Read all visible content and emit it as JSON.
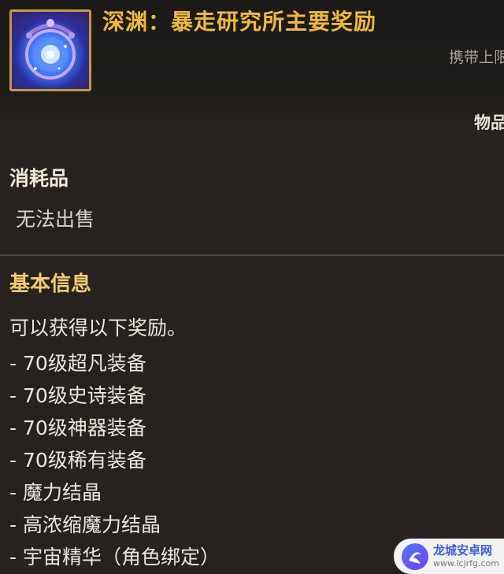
{
  "item": {
    "icon": "abyss-portal-icon",
    "title": "深渊：暴走研究所主要奖励",
    "carry_limit": "携带上限",
    "type_label": "物品"
  },
  "consumable": {
    "title": "消耗品",
    "sell_status": "无法出售"
  },
  "basic_info": {
    "title": "基本信息",
    "intro": "可以获得以下奖励。",
    "rewards": [
      "- 70级超凡装备",
      "- 70级史诗装备",
      "- 70级神器装备",
      "- 70级稀有装备",
      "- 魔力结晶",
      "- 高浓缩魔力结晶",
      "- 宇宙精华（角色绑定）"
    ]
  },
  "watermark": {
    "icon": "dragon-city-logo-icon",
    "title": "龙城安卓网",
    "url": "www.lcjrfg.com"
  },
  "colors": {
    "title_gold": "#f0b93b",
    "section_gold": "#f0cc6e",
    "background": "#27221f",
    "frame_gold": "#c89b3a"
  }
}
